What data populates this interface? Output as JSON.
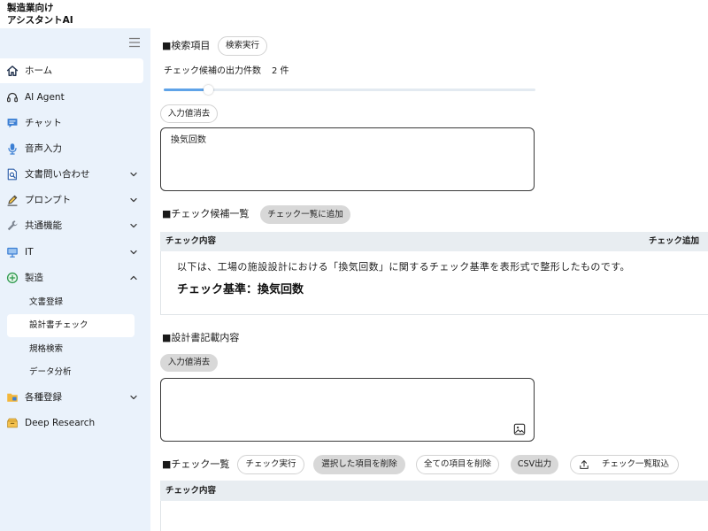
{
  "app": {
    "title_line1": "製造業向け",
    "title_line2": "アシスタントAI"
  },
  "colors": {
    "sidebar_bg": "#eaf2fb",
    "accent": "#5fa3e8",
    "button_gray": "#d8d8d8",
    "table_header_bg": "#e8edf1"
  },
  "sidebar": {
    "menu_icon": "hamburger-icon",
    "items": [
      {
        "label": "ホーム",
        "icon": "home-icon",
        "selected": true
      },
      {
        "label": "AI Agent",
        "icon": "headset-icon"
      },
      {
        "label": "チャット",
        "icon": "chat-icon"
      },
      {
        "label": "音声入力",
        "icon": "mic-icon"
      },
      {
        "label": "文書問い合わせ",
        "icon": "document-search-icon",
        "chevron": "chevron-down-icon"
      },
      {
        "label": "プロンプト",
        "icon": "pencil-icon",
        "chevron": "chevron-down-icon"
      },
      {
        "label": "共通機能",
        "icon": "tools-icon",
        "chevron": "chevron-down-icon"
      },
      {
        "label": "IT",
        "icon": "monitor-icon",
        "chevron": "chevron-down-icon"
      },
      {
        "label": "製造",
        "icon": "plus-circle-icon",
        "chevron": "chevron-up-icon",
        "expanded": true,
        "children": [
          {
            "label": "文書登録"
          },
          {
            "label": "設計書チェック",
            "selected": true
          },
          {
            "label": "規格検索"
          },
          {
            "label": "データ分析"
          }
        ]
      },
      {
        "label": "各種登録",
        "icon": "folder-icon",
        "chevron": "chevron-down-icon"
      },
      {
        "label": "Deep Research",
        "icon": "archive-icon"
      }
    ]
  },
  "search": {
    "heading": "■検索項目",
    "run_button": "検索実行",
    "count_label": "チェック候補の出力件数",
    "count_value": "2 件",
    "slider_fraction": 0.12,
    "clear_button": "入力値消去",
    "input_value": "換気回数"
  },
  "candidates": {
    "heading": "■チェック候補一覧",
    "add_button": "チェック一覧に追加",
    "columns": [
      "チェック内容",
      "チェック追加"
    ],
    "rows": [
      {
        "intro": "以下は、工場の施設設計における「換気回数」に関するチェック基準を表形式で整形したものです。",
        "criteria_title": "チェック基準：換気回数"
      }
    ]
  },
  "design_doc": {
    "heading": "■設計書記載内容",
    "clear_button": "入力値消去",
    "input_value": "",
    "attach_icon": "image-icon"
  },
  "checklist": {
    "heading": "■チェック一覧",
    "buttons": [
      {
        "label": "チェック実行",
        "filled": false
      },
      {
        "label": "選択した項目を削除",
        "filled": true
      },
      {
        "label": "全ての項目を削除",
        "filled": false
      },
      {
        "label": "CSV出力",
        "filled": true
      },
      {
        "label": "チェック一覧取込",
        "filled": false,
        "icon": "upload-icon"
      }
    ],
    "columns": [
      "チェック内容"
    ],
    "rows": []
  }
}
